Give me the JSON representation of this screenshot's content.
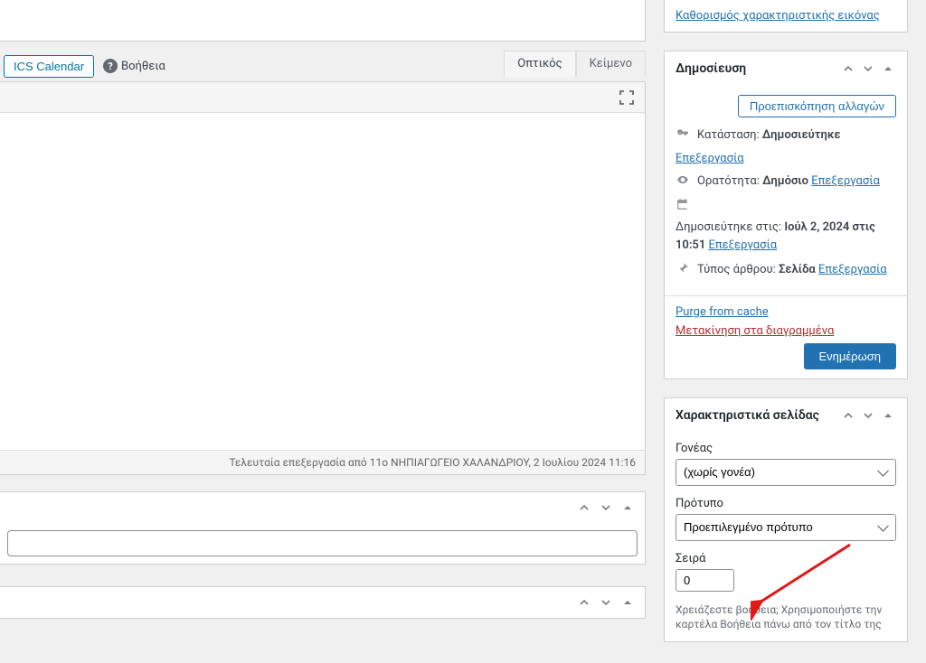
{
  "toolbar": {
    "ics_calendar_label": "ICS Calendar",
    "help_label": "Βοήθεια"
  },
  "editor": {
    "tabs": {
      "visual": "Οπτικός",
      "text": "Κείμενο"
    },
    "footer_status": "Τελευταία επεξεργασία από 11ο ΝΗΠΙΑΓΩΓΕΙΟ ΧΑΛΑΝΔΡΙΟΥ, 2 Ιουλίου 2024 11:16"
  },
  "featured_image": {
    "set_link": "Καθορισμός χαρακτηριστικής εικόνας"
  },
  "publish": {
    "panel_title": "Δημοσίευση",
    "preview_button": "Προεπισκόπηση αλλαγών",
    "status_label": "Κατάσταση:",
    "status_value": "Δημοσιεύτηκε",
    "visibility_label": "Ορατότητα:",
    "visibility_value": "Δημόσιο",
    "published_on_label": "Δημοσιεύτηκε στις:",
    "published_on_value": "Ιούλ 2, 2024 στις 10:51",
    "post_type_label": "Τύπος άρθρου:",
    "post_type_value": "Σελίδα",
    "edit_link": "Επεξεργασία",
    "purge_link": "Purge from cache",
    "trash_link": "Μετακίνηση στα διαγραμμένα",
    "update_button": "Ενημέρωση"
  },
  "page_attributes": {
    "panel_title": "Χαρακτηριστικά σελίδας",
    "parent_label": "Γονέας",
    "parent_value": "(χωρίς γονέα)",
    "template_label": "Πρότυπο",
    "template_value": "Προεπιλεγμένο πρότυπο",
    "order_label": "Σειρά",
    "order_value": "0",
    "help_note": "Χρειάζεστε βοήθεια; Χρησιμοποιήστε την καρτέλα Βοήθεια πάνω από τον τίτλο της"
  }
}
